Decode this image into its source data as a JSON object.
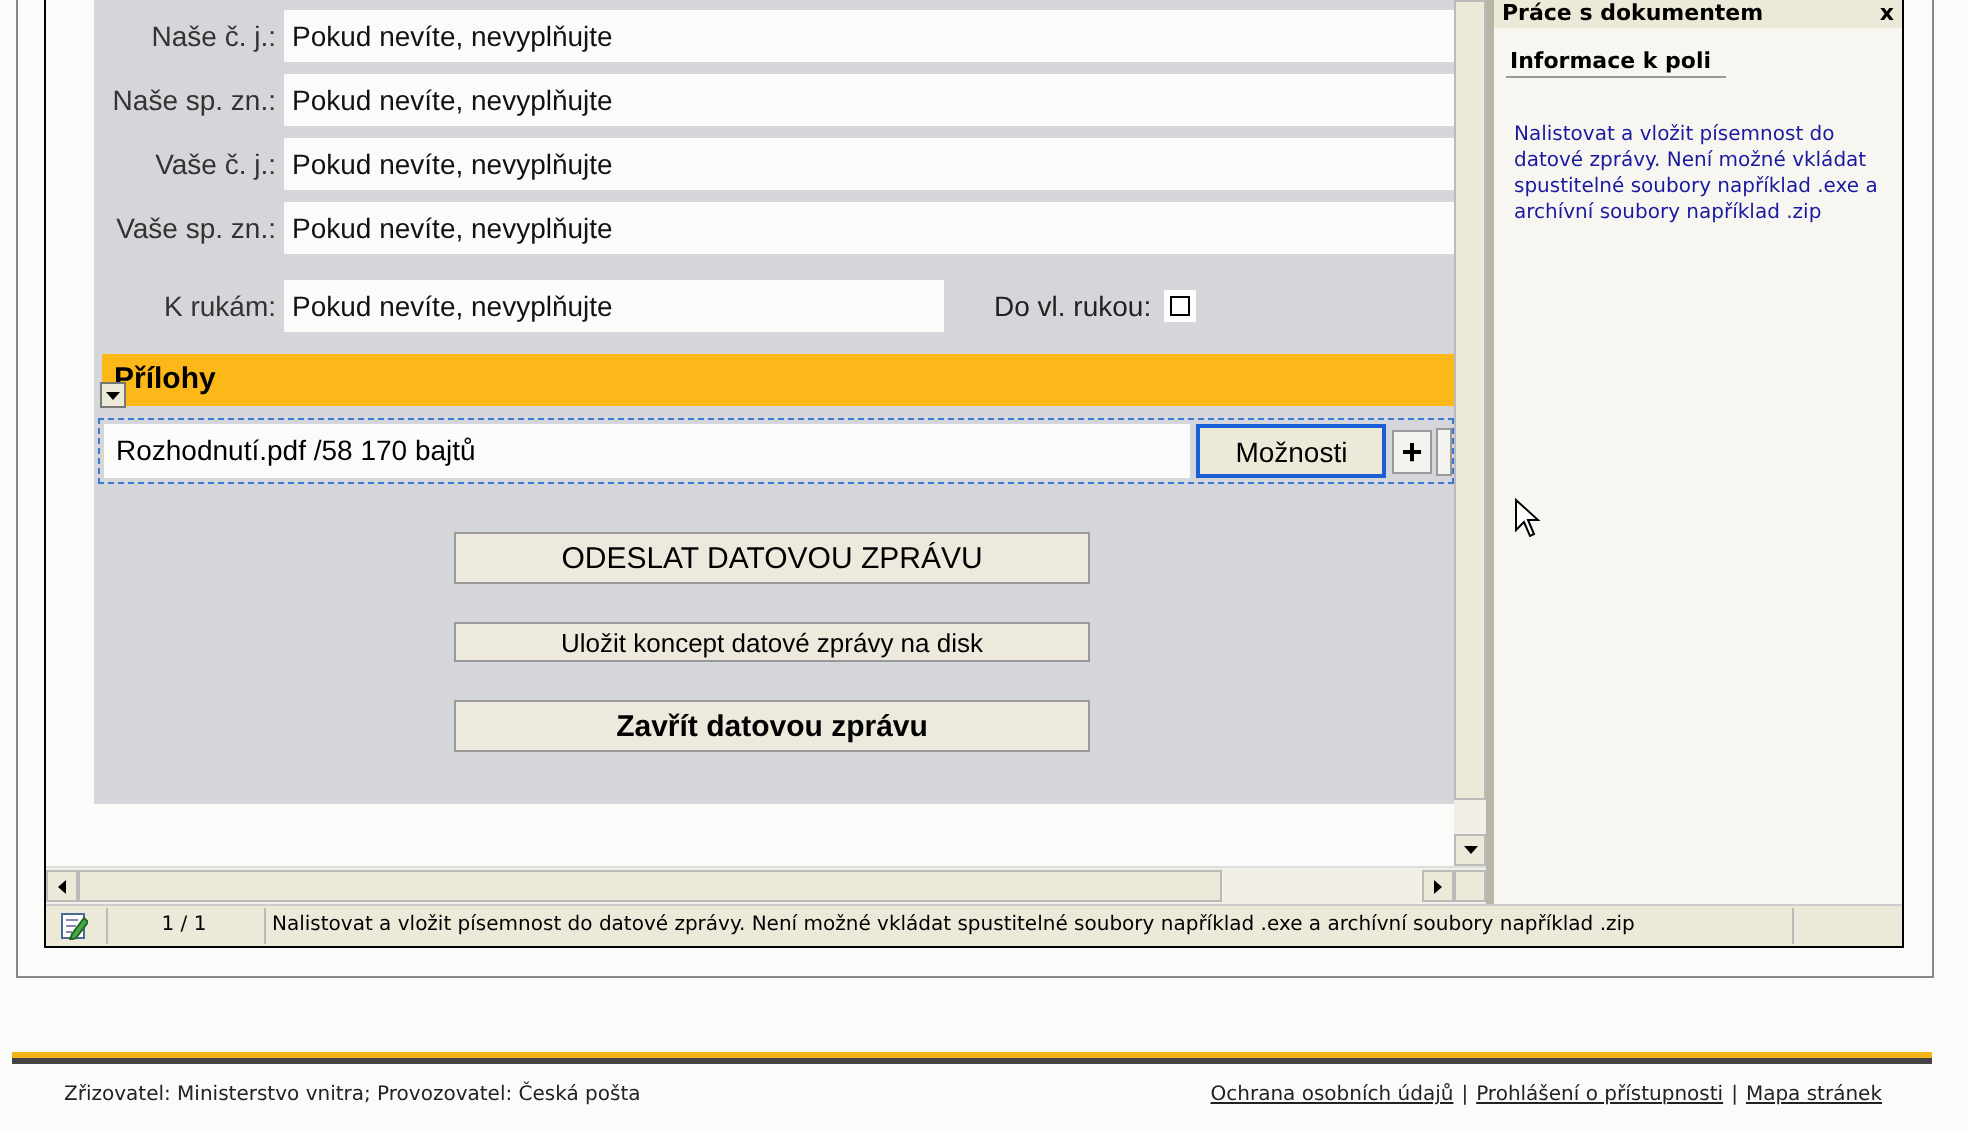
{
  "form": {
    "fields": [
      {
        "label": "Naše č. j.:",
        "placeholder": "Pokud nevíte, nevyplňujte"
      },
      {
        "label": "Naše sp. zn.:",
        "placeholder": "Pokud nevíte, nevyplňujte"
      },
      {
        "label": "Vaše č. j.:",
        "placeholder": "Pokud nevíte, nevyplňujte"
      },
      {
        "label": "Vaše sp. zn.:",
        "placeholder": "Pokud nevíte, nevyplňujte"
      }
    ],
    "addressee": {
      "label": "K rukám:",
      "placeholder": "Pokud nevíte, nevyplňujte"
    },
    "personal_delivery": {
      "label": "Do vl. rukou:",
      "checked": false
    },
    "attachments": {
      "title": "Přílohy",
      "items": [
        {
          "name": "Rozhodnutí.pdf /58 170 bajtů",
          "options_button": "Možnosti",
          "add_button": "+"
        }
      ]
    },
    "actions": [
      {
        "label": "ODESLAT DATOVOU ZPRÁVU",
        "kind": "primary"
      },
      {
        "label": "Uložit koncept datové zprávy na disk",
        "kind": "secondary"
      },
      {
        "label": "Zavřít datovou zprávu",
        "kind": "normal"
      }
    ]
  },
  "side_panel": {
    "title": "Práce s dokumentem",
    "close": "x",
    "section": "Informace k poli",
    "text": "Nalistovat a vložit písemnost do datové zprávy. Není možné vkládat spustitelné soubory například .exe a archívní soubory například .zip"
  },
  "status_bar": {
    "page": "1 / 1",
    "message": "Nalistovat a vložit písemnost do datové zprávy. Není možné vkládat spustitelné soubory například .exe a archívní soubory například .zip"
  },
  "footer": {
    "text": "Zřizovatel: Ministerstvo vnitra; Provozovatel: Česká pošta",
    "separator": "|",
    "links": [
      "Ochrana osobních údajů",
      "Prohlášení o přístupnosti",
      "Mapa stránek"
    ]
  }
}
